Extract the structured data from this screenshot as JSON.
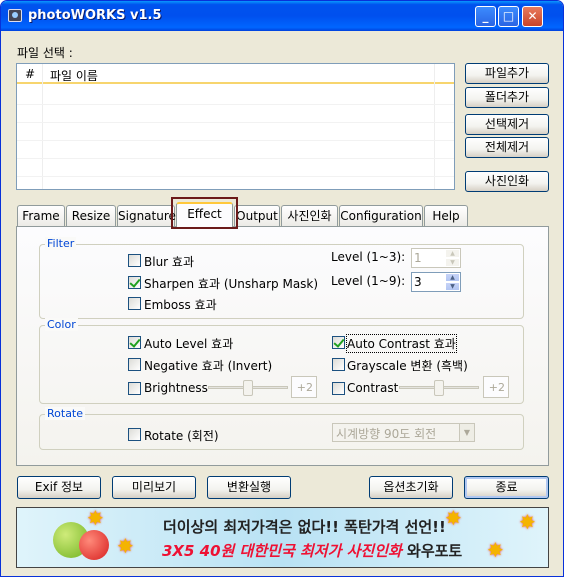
{
  "window": {
    "title": "photoWORKS v1.5",
    "min": "_",
    "max": "□",
    "close": "✕"
  },
  "file_select": {
    "label": "파일 선택 :",
    "columns": [
      "#",
      "파일 이름"
    ]
  },
  "right_buttons": [
    "파일추가",
    "폴더추가",
    "선택제거",
    "전체제거",
    "사진인화"
  ],
  "tabs": [
    "Frame",
    "Resize",
    "Signature",
    "Effect",
    "Output",
    "사진인화",
    "Configuration",
    "Help"
  ],
  "active_tab": "Effect",
  "filter": {
    "title": "Filter",
    "blur": {
      "label": "Blur 효과",
      "checked": false
    },
    "sharpen": {
      "label": "Sharpen 효과 (Unsharp Mask)",
      "checked": true
    },
    "emboss": {
      "label": "Emboss 효과",
      "checked": false
    },
    "level1_label": "Level (1~3):",
    "level1_value": "1",
    "level2_label": "Level (1~9):",
    "level2_value": "3"
  },
  "color": {
    "title": "Color",
    "auto_level": {
      "label": "Auto Level 효과",
      "checked": true
    },
    "auto_contrast": {
      "label": "Auto Contrast 효과",
      "checked": true
    },
    "negative": {
      "label": "Negative 효과 (Invert)",
      "checked": false
    },
    "grayscale": {
      "label": "Grayscale 변환 (흑백)",
      "checked": false
    },
    "brightness": {
      "label": "Brightness",
      "checked": false,
      "value": "+2"
    },
    "contrast": {
      "label": "Contrast",
      "checked": false,
      "value": "+2"
    }
  },
  "rotate": {
    "title": "Rotate",
    "rotate": {
      "label": "Rotate (회전)",
      "checked": false
    },
    "direction": "시계방향 90도 회전"
  },
  "bottom_buttons": {
    "exif": "Exif 정보",
    "preview": "미리보기",
    "convert": "변환실행",
    "reset": "옵션초기화",
    "exit": "종료"
  },
  "banner": {
    "line1": "더이상의 최저가격은 없다!! 폭탄가격 선언!!",
    "line2_prefix": "3X5 40원 대한민국 최저가 사진인화",
    "line2_suffix": " 와우포토"
  }
}
